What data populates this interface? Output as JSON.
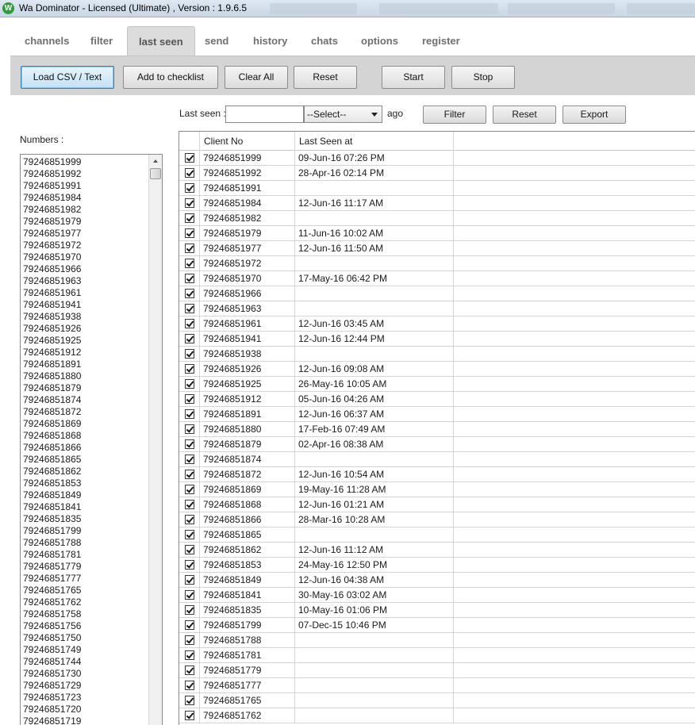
{
  "window": {
    "title": "Wa Dominator - Licensed (Ultimate) , Version : 1.9.6.5",
    "icon_letter": "W"
  },
  "tabs": [
    {
      "label": "channels"
    },
    {
      "label": "filter"
    },
    {
      "label": "last seen",
      "active": true
    },
    {
      "label": "send"
    },
    {
      "label": "history"
    },
    {
      "label": "chats"
    },
    {
      "label": "options"
    },
    {
      "label": "register"
    }
  ],
  "toolbar": {
    "load_csv": "Load CSV / Text",
    "add_checklist": "Add to checklist",
    "clear_all": "Clear All",
    "reset": "Reset",
    "start": "Start",
    "stop": "Stop"
  },
  "filter_bar": {
    "last_seen_label": "Last seen :",
    "last_seen_value": "",
    "select_value": "--Select--",
    "ago_label": "ago",
    "filter_button": "Filter",
    "reset_button": "Reset",
    "export_button": "Export"
  },
  "numbers_panel": {
    "label": "Numbers :",
    "items": [
      "79246851999",
      "79246851992",
      "79246851991",
      "79246851984",
      "79246851982",
      "79246851979",
      "79246851977",
      "79246851972",
      "79246851970",
      "79246851966",
      "79246851963",
      "79246851961",
      "79246851941",
      "79246851938",
      "79246851926",
      "79246851925",
      "79246851912",
      "79246851891",
      "79246851880",
      "79246851879",
      "79246851874",
      "79246851872",
      "79246851869",
      "79246851868",
      "79246851866",
      "79246851865",
      "79246851862",
      "79246851853",
      "79246851849",
      "79246851841",
      "79246851835",
      "79246851799",
      "79246851788",
      "79246851781",
      "79246851779",
      "79246851777",
      "79246851765",
      "79246851762",
      "79246851758",
      "79246851756",
      "79246851750",
      "79246851749",
      "79246851744",
      "79246851730",
      "79246851729",
      "79246851723",
      "79246851720",
      "79246851719"
    ]
  },
  "grid": {
    "columns": [
      "Client No",
      "Last Seen at"
    ],
    "rows": [
      {
        "client": "79246851999",
        "last_seen": "09-Jun-16 07:26 PM"
      },
      {
        "client": "79246851992",
        "last_seen": "28-Apr-16 02:14 PM"
      },
      {
        "client": "79246851991",
        "last_seen": ""
      },
      {
        "client": "79246851984",
        "last_seen": "12-Jun-16 11:17 AM"
      },
      {
        "client": "79246851982",
        "last_seen": ""
      },
      {
        "client": "79246851979",
        "last_seen": "11-Jun-16 10:02 AM"
      },
      {
        "client": "79246851977",
        "last_seen": "12-Jun-16 11:50 AM"
      },
      {
        "client": "79246851972",
        "last_seen": ""
      },
      {
        "client": "79246851970",
        "last_seen": "17-May-16 06:42 PM"
      },
      {
        "client": "79246851966",
        "last_seen": ""
      },
      {
        "client": "79246851963",
        "last_seen": ""
      },
      {
        "client": "79246851961",
        "last_seen": "12-Jun-16 03:45 AM"
      },
      {
        "client": "79246851941",
        "last_seen": "12-Jun-16 12:44 PM"
      },
      {
        "client": "79246851938",
        "last_seen": ""
      },
      {
        "client": "79246851926",
        "last_seen": "12-Jun-16 09:08 AM"
      },
      {
        "client": "79246851925",
        "last_seen": "26-May-16 10:05 AM"
      },
      {
        "client": "79246851912",
        "last_seen": "05-Jun-16 04:26 AM"
      },
      {
        "client": "79246851891",
        "last_seen": "12-Jun-16 06:37 AM"
      },
      {
        "client": "79246851880",
        "last_seen": "17-Feb-16 07:49 AM"
      },
      {
        "client": "79246851879",
        "last_seen": "02-Apr-16 08:38 AM"
      },
      {
        "client": "79246851874",
        "last_seen": ""
      },
      {
        "client": "79246851872",
        "last_seen": "12-Jun-16 10:54 AM"
      },
      {
        "client": "79246851869",
        "last_seen": "19-May-16 11:28 AM"
      },
      {
        "client": "79246851868",
        "last_seen": "12-Jun-16 01:21 AM"
      },
      {
        "client": "79246851866",
        "last_seen": "28-Mar-16 10:28 AM"
      },
      {
        "client": "79246851865",
        "last_seen": ""
      },
      {
        "client": "79246851862",
        "last_seen": "12-Jun-16 11:12 AM"
      },
      {
        "client": "79246851853",
        "last_seen": "24-May-16 12:50 PM"
      },
      {
        "client": "79246851849",
        "last_seen": "12-Jun-16 04:38 AM"
      },
      {
        "client": "79246851841",
        "last_seen": "30-May-16 03:02 AM"
      },
      {
        "client": "79246851835",
        "last_seen": "10-May-16 01:06 PM"
      },
      {
        "client": "79246851799",
        "last_seen": "07-Dec-15 10:46 PM"
      },
      {
        "client": "79246851788",
        "last_seen": ""
      },
      {
        "client": "79246851781",
        "last_seen": ""
      },
      {
        "client": "79246851779",
        "last_seen": ""
      },
      {
        "client": "79246851777",
        "last_seen": ""
      },
      {
        "client": "79246851765",
        "last_seen": ""
      },
      {
        "client": "79246851762",
        "last_seen": ""
      }
    ]
  }
}
